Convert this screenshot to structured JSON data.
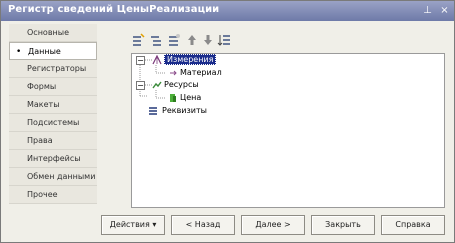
{
  "window": {
    "title": "Регистр сведений ЦеныРеализации"
  },
  "sidebar": {
    "items": [
      {
        "label": "Основные"
      },
      {
        "label": "Данные"
      },
      {
        "label": "Регистраторы"
      },
      {
        "label": "Формы"
      },
      {
        "label": "Макеты"
      },
      {
        "label": "Подсистемы"
      },
      {
        "label": "Права"
      },
      {
        "label": "Интерфейсы"
      },
      {
        "label": "Обмен данными"
      },
      {
        "label": "Прочее"
      }
    ],
    "active_item": "Данные"
  },
  "toolbar": {
    "icons": [
      "add-icon",
      "add-child-icon",
      "edit-icon",
      "move-up-icon",
      "move-down-icon",
      "sort-icon"
    ]
  },
  "tree": {
    "dimensions": {
      "label": "Измерения",
      "child": "Материал"
    },
    "resources": {
      "label": "Ресурсы",
      "child": "Цена"
    },
    "attributes": {
      "label": "Реквизиты"
    }
  },
  "buttons": {
    "actions": "Действия",
    "back": "< Назад",
    "next": "Далее >",
    "close": "Закрыть",
    "help": "Справка"
  },
  "colors": {
    "selection": "#1a2c8c",
    "titlebar": "#7d86b2"
  }
}
